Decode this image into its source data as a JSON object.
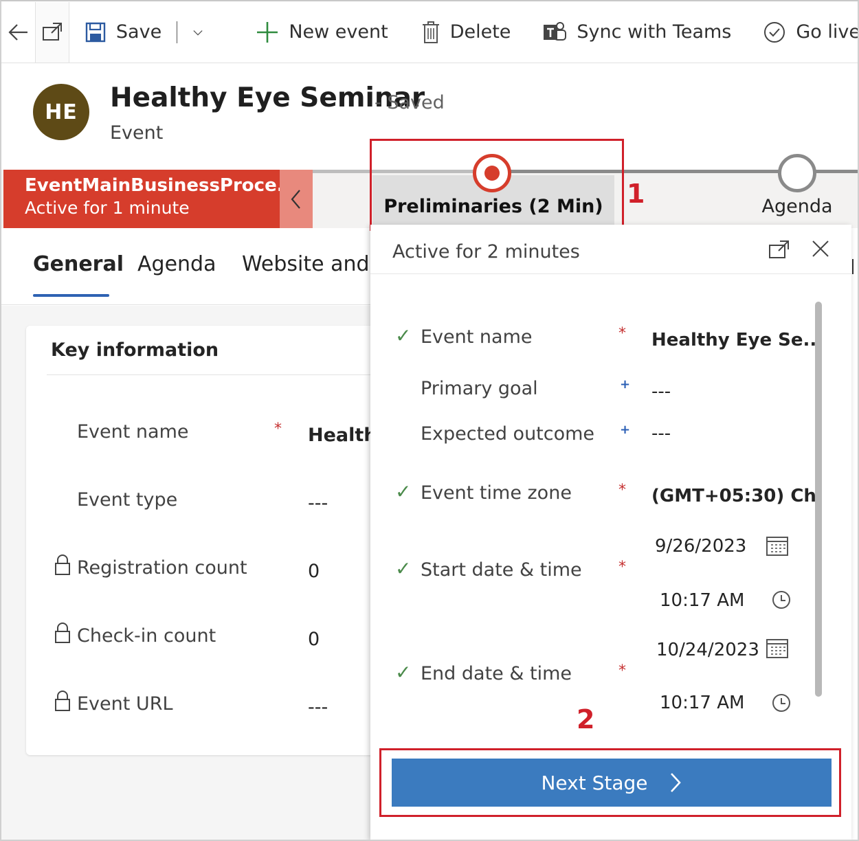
{
  "toolbar": {
    "save_label": "Save",
    "new_event_label": "New event",
    "delete_label": "Delete",
    "sync_label": "Sync with Teams",
    "go_live_label": "Go live"
  },
  "record": {
    "initials": "HE",
    "title": "Healthy Eye Seminar",
    "status": "- Saved",
    "entity": "Event",
    "avatar_color": "#5e4a16"
  },
  "bpf": {
    "process_name": "EventMainBusinessProce...",
    "process_duration": "Active for 1 minute",
    "active_color": "#d63d2c",
    "stages": [
      {
        "label": "Preliminaries  (2 Min)",
        "state": "active"
      },
      {
        "label": "Agenda",
        "state": "pending"
      }
    ]
  },
  "annotations": {
    "marker1": "1",
    "marker2": "2",
    "color": "#d0202a"
  },
  "tabs": [
    {
      "label": "General",
      "selected": true
    },
    {
      "label": "Agenda",
      "selected": false
    },
    {
      "label": "Website and f",
      "selected": false
    }
  ],
  "key_info": {
    "title": "Key information",
    "fields": [
      {
        "label": "Event name",
        "value": "Healthy",
        "required": "*",
        "locked": false
      },
      {
        "label": "Event type",
        "value": "---",
        "locked": false
      },
      {
        "label": "Registration count",
        "value": "0",
        "locked": true
      },
      {
        "label": "Check-in count",
        "value": "0",
        "locked": true
      },
      {
        "label": "Event URL",
        "value": "---",
        "locked": true
      }
    ]
  },
  "flyout": {
    "active_text": "Active for 2 minutes",
    "fields": {
      "event_name": {
        "label": "Event name",
        "value": "Healthy Eye Se...",
        "req": "*"
      },
      "primary_goal": {
        "label": "Primary goal",
        "value": "---",
        "req": "+"
      },
      "expected_outcome": {
        "label": "Expected outcome",
        "value": "---",
        "req": "+"
      },
      "time_zone": {
        "label": "Event time zone",
        "value": "(GMT+05:30) Ch",
        "req": "*"
      },
      "start": {
        "label": "Start date & time",
        "date": "9/26/2023",
        "time": "10:17 AM",
        "req": "*"
      },
      "end": {
        "label": "End date & time",
        "date": "10/24/2023",
        "time": "10:17 AM",
        "req": "*"
      }
    },
    "check_mark": "✓",
    "next_stage_label": "Next Stage",
    "button_color": "#3b7bbf"
  }
}
